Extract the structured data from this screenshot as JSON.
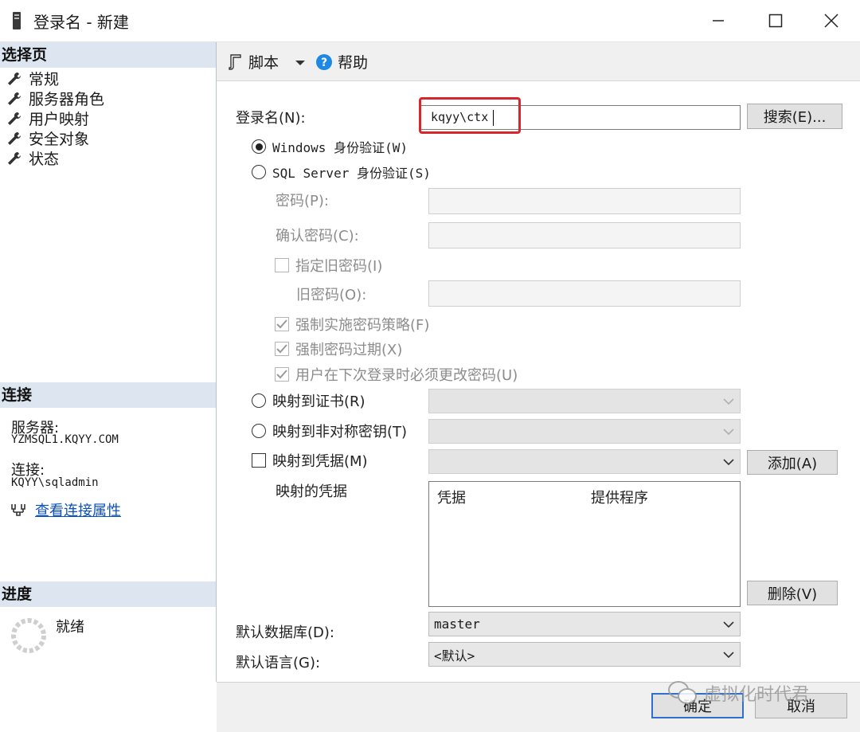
{
  "window": {
    "title": "登录名 - 新建"
  },
  "left": {
    "select_page_header": "选择页",
    "pages": [
      {
        "label": "常规"
      },
      {
        "label": "服务器角色"
      },
      {
        "label": "用户映射"
      },
      {
        "label": "安全对象"
      },
      {
        "label": "状态"
      }
    ],
    "connection_header": "连接",
    "server_label": "服务器:",
    "server_value": "YZMSQL1.KQYY.COM",
    "connection_label": "连接:",
    "connection_value": "KQYY\\sqladmin",
    "view_props_link": "查看连接属性",
    "progress_header": "进度",
    "progress_status": "就绪"
  },
  "toolbar": {
    "script_label": "脚本",
    "help_label": "帮助"
  },
  "form": {
    "login_name_label": "登录名(N):",
    "login_name_value": "kqyy\\ctx",
    "search_button": "搜索(E)...",
    "windows_auth_label": "Windows 身份验证(W)",
    "sql_auth_label": "SQL Server 身份验证(S)",
    "password_label": "密码(P):",
    "confirm_password_label": "确认密码(C):",
    "specify_old_password_label": "指定旧密码(I)",
    "old_password_label": "旧密码(O):",
    "enforce_policy_label": "强制实施密码策略(F)",
    "enforce_expiration_label": "强制密码过期(X)",
    "must_change_label": "用户在下次登录时必须更改密码(U)",
    "map_certificate_label": "映射到证书(R)",
    "map_asym_key_label": "映射到非对称密钥(T)",
    "map_credential_label": "映射到凭据(M)",
    "add_button": "添加(A)",
    "mapped_credentials_label": "映射的凭据",
    "grid_columns": [
      "凭据",
      "提供程序"
    ],
    "remove_button": "删除(V)",
    "default_db_label": "默认数据库(D):",
    "default_db_value": "master",
    "default_lang_label": "默认语言(G):",
    "default_lang_value": "<默认>"
  },
  "footer": {
    "ok_button": "确定",
    "cancel_button": "取消",
    "watermark": "虚拟化时代君"
  },
  "colors": {
    "highlight_box": "#d9262c",
    "link": "#0b4fc0",
    "help_icon": "#1e88e5",
    "section_header_bg": "#dde6f0"
  }
}
